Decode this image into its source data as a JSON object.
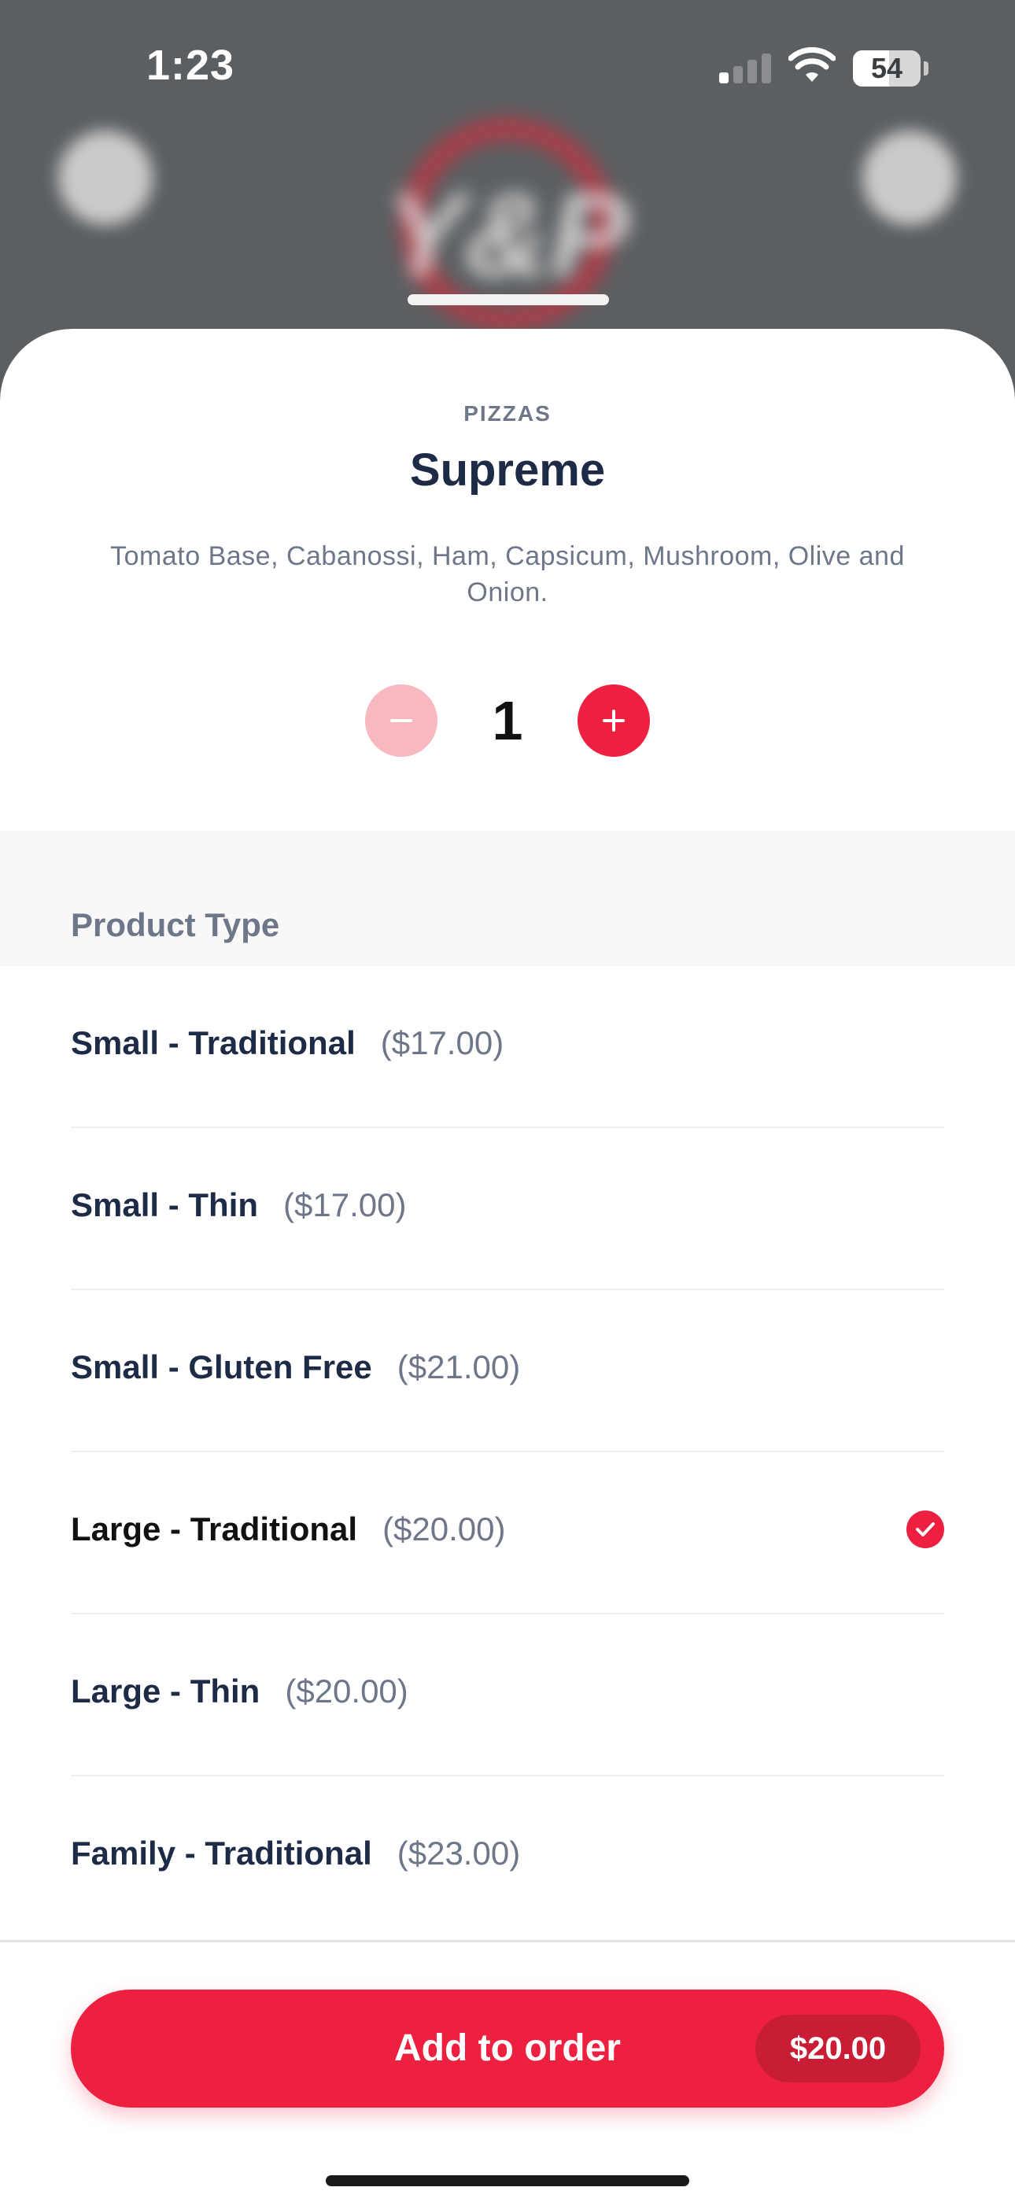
{
  "status_bar": {
    "time": "1:23",
    "battery_level": "54",
    "battery_fraction": 0.54,
    "signal_bars_active": 1,
    "signal_bars_total": 4
  },
  "product": {
    "category": "PIZZAS",
    "name": "Supreme",
    "description": "Tomato Base, Cabanossi, Ham, Capsicum, Mushroom, Olive and Onion."
  },
  "quantity": {
    "value": "1"
  },
  "product_type": {
    "heading": "Product Type",
    "options": [
      {
        "label": "Small - Traditional",
        "price": "($17.00)",
        "selected": false
      },
      {
        "label": "Small - Thin",
        "price": "($17.00)",
        "selected": false
      },
      {
        "label": "Small - Gluten Free",
        "price": "($21.00)",
        "selected": false
      },
      {
        "label": "Large - Traditional",
        "price": "($20.00)",
        "selected": true
      },
      {
        "label": "Large - Thin",
        "price": "($20.00)",
        "selected": false
      },
      {
        "label": "Family - Traditional",
        "price": "($23.00)",
        "selected": false
      }
    ]
  },
  "footer": {
    "add_label": "Add to order",
    "total": "$20.00"
  },
  "colors": {
    "accent": "#ee2040",
    "accent_light": "#f7b8bf",
    "text_dark": "#1e2b47",
    "text_muted": "#6e7689"
  },
  "icons": {
    "minus": "minus-icon",
    "plus": "plus-icon",
    "check": "check-icon",
    "wifi": "wifi-icon",
    "signal": "signal-icon",
    "battery": "battery-icon"
  }
}
